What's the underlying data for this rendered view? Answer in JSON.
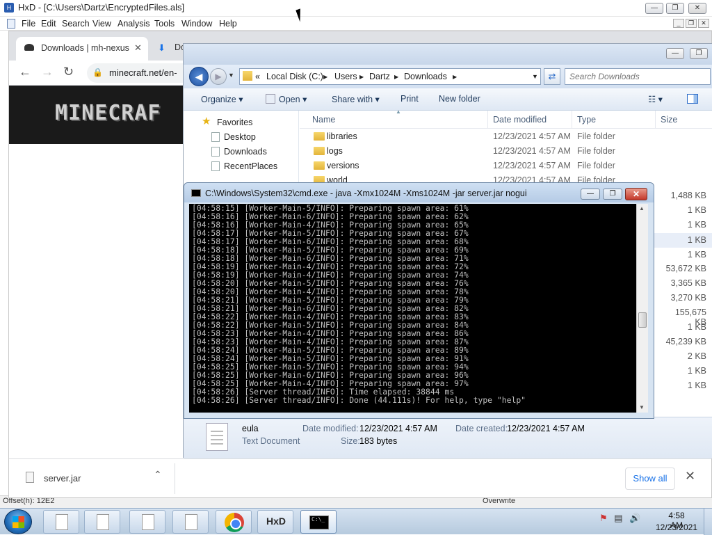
{
  "hxd": {
    "title": "HxD - [C:\\Users\\Dartz\\EncryptedFiles.als]",
    "menu": [
      "File",
      "Edit",
      "Search",
      "View",
      "Analysis",
      "Tools",
      "Window",
      "Help"
    ],
    "status_offset": "Offset(h): 12E2",
    "status_mode": "Overwrite"
  },
  "chrome": {
    "tab1_title": "Downloads | mh-nexus",
    "tab2_title": "Do",
    "url": "minecraft.net/en-",
    "banner_logo": "MINECRAF",
    "download_file": "server.jar",
    "show_all": "Show all"
  },
  "explorer": {
    "breadcrumb": [
      "«",
      "Local Disk (C:)",
      "Users",
      "Dartz",
      "Downloads"
    ],
    "search_placeholder": "Search Downloads",
    "commands": [
      "Organize",
      "Open",
      "Share with",
      "Print",
      "New folder"
    ],
    "nav": {
      "favorites": "Favorites",
      "items": [
        "Desktop",
        "Downloads",
        "RecentPlaces"
      ]
    },
    "columns": [
      "Name",
      "Date modified",
      "Type",
      "Size"
    ],
    "folders": [
      {
        "name": "libraries",
        "date": "12/23/2021 4:57 AM",
        "type": "File folder"
      },
      {
        "name": "logs",
        "date": "12/23/2021 4:57 AM",
        "type": "File folder"
      },
      {
        "name": "versions",
        "date": "12/23/2021 4:57 AM",
        "type": "File folder"
      },
      {
        "name": "world",
        "date": "12/23/2021 4:57 AM",
        "type": "File folder"
      }
    ],
    "sizes": [
      "1,488 KB",
      "1 KB",
      "1 KB",
      "1 KB",
      "1 KB",
      "53,672 KB",
      "3,365 KB",
      "3,270 KB",
      "155,675 KB",
      "1 KB",
      "45,239 KB",
      "2 KB",
      "1 KB",
      "1 KB"
    ],
    "details": {
      "name": "eula",
      "kind": "Text Document",
      "modified_label": "Date modified:",
      "modified": "12/23/2021 4:57 AM",
      "created_label": "Date created:",
      "created": "12/23/2021 4:57 AM",
      "size_label": "Size:",
      "size": "183 bytes"
    }
  },
  "cmd": {
    "title": "C:\\Windows\\System32\\cmd.exe - java  -Xmx1024M -Xms1024M -jar server.jar nogui",
    "lines": [
      "[04:58:15] [Worker-Main-5/INFO]: Preparing spawn area: 61%",
      "[04:58:16] [Worker-Main-6/INFO]: Preparing spawn area: 62%",
      "[04:58:16] [Worker-Main-4/INFO]: Preparing spawn area: 65%",
      "[04:58:17] [Worker-Main-5/INFO]: Preparing spawn area: 67%",
      "[04:58:17] [Worker-Main-6/INFO]: Preparing spawn area: 68%",
      "[04:58:18] [Worker-Main-5/INFO]: Preparing spawn area: 69%",
      "[04:58:18] [Worker-Main-6/INFO]: Preparing spawn area: 71%",
      "[04:58:19] [Worker-Main-4/INFO]: Preparing spawn area: 72%",
      "[04:58:19] [Worker-Main-4/INFO]: Preparing spawn area: 74%",
      "[04:58:20] [Worker-Main-5/INFO]: Preparing spawn area: 76%",
      "[04:58:20] [Worker-Main-4/INFO]: Preparing spawn area: 78%",
      "[04:58:21] [Worker-Main-5/INFO]: Preparing spawn area: 79%",
      "[04:58:21] [Worker-Main-6/INFO]: Preparing spawn area: 82%",
      "[04:58:22] [Worker-Main-4/INFO]: Preparing spawn area: 83%",
      "[04:58:22] [Worker-Main-5/INFO]: Preparing spawn area: 84%",
      "[04:58:23] [Worker-Main-4/INFO]: Preparing spawn area: 86%",
      "[04:58:23] [Worker-Main-4/INFO]: Preparing spawn area: 87%",
      "[04:58:24] [Worker-Main-5/INFO]: Preparing spawn area: 89%",
      "[04:58:24] [Worker-Main-5/INFO]: Preparing spawn area: 91%",
      "[04:58:25] [Worker-Main-5/INFO]: Preparing spawn area: 94%",
      "[04:58:25] [Worker-Main-6/INFO]: Preparing spawn area: 96%",
      "[04:58:25] [Worker-Main-4/INFO]: Preparing spawn area: 97%",
      "[04:58:26] [Server thread/INFO]: Time elapsed: 38844 ms",
      "[04:58:26] [Server thread/INFO]: Done (44.111s)! For help, type \"help\""
    ]
  },
  "taskbar": {
    "time": "4:58 AM",
    "date": "12/23/2021",
    "hxd_label": "HxD",
    "cmd_label": "C:\\_"
  }
}
